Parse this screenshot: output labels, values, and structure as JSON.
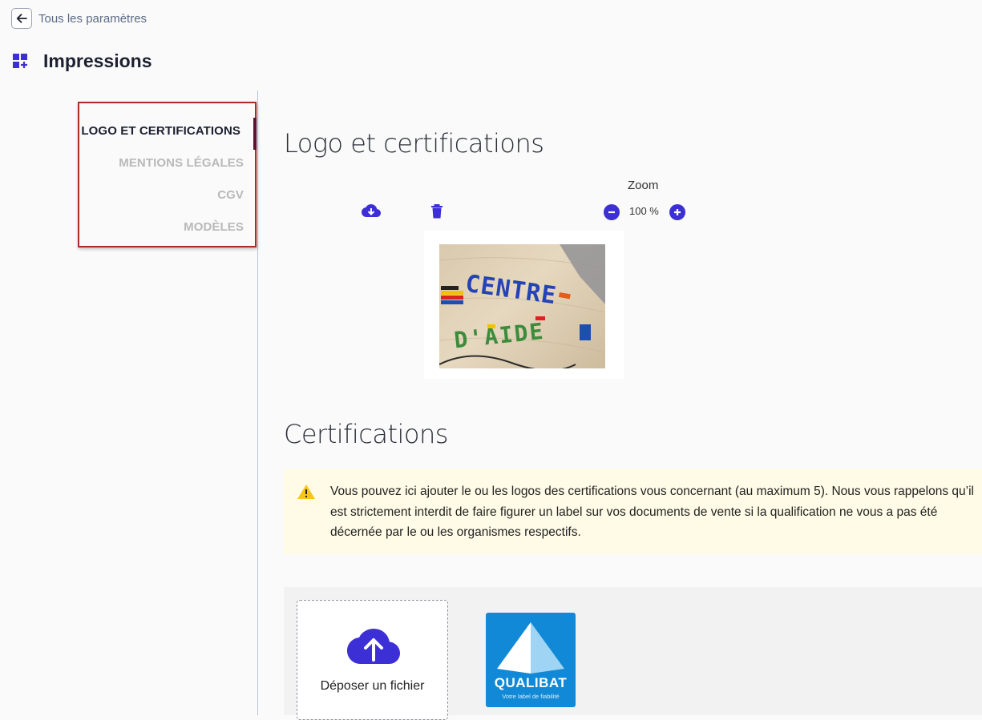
{
  "header": {
    "back_label": "Tous les paramètres",
    "title": "Impressions",
    "title_icon": "dashboard-add-icon"
  },
  "sidebar": {
    "items": [
      {
        "label": "LOGO ET CERTIFICATIONS",
        "active": true
      },
      {
        "label": "MENTIONS LÉGALES",
        "active": false
      },
      {
        "label": "CGV",
        "active": false
      },
      {
        "label": "MODÈLES",
        "active": false
      }
    ]
  },
  "logo_section": {
    "title": "Logo et certifications",
    "zoom_label": "Zoom",
    "zoom_value": "100 %",
    "image_text": [
      "CENTRE",
      "D'AIDE"
    ]
  },
  "certifications": {
    "title": "Certifications",
    "warning": "Vous pouvez ici ajouter le ou les logos des certifications vous concernant (au maximum 5). Nous vous rappelons qu’il est strictement interdit de faire figurer un label sur vos documents de vente si la qualification ne vous a pas été décernée par le ou les organismes respectifs.",
    "drop_label": "Déposer un fichier",
    "badge": {
      "name": "QUALIBAT",
      "tagline": "Votre label de fiabilité"
    }
  },
  "colors": {
    "accent": "#3c2fd6",
    "warning_bg": "#fffbe6",
    "warning_icon": "#f5c518",
    "qualibat_blue": "#1189d6",
    "highlight_border": "#a82c2c"
  }
}
